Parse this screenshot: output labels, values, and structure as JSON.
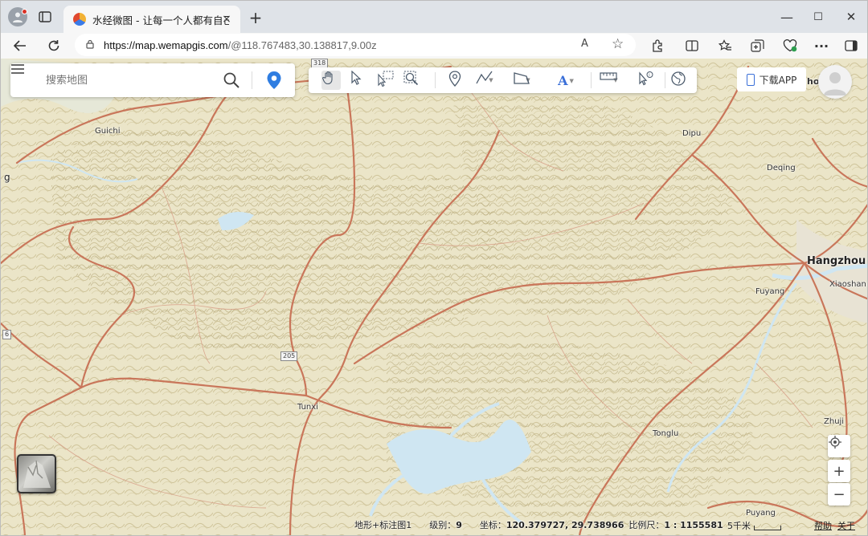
{
  "browser": {
    "tab_title": "水经微图 - 让每一个人都有自己的",
    "tab_close": "×",
    "new_tab": "+",
    "url_host": "https://map.wemapgis.com",
    "url_rest": "/@118.767483,30.138817,9.00z",
    "read_aloud": "A",
    "window_minimize": "—",
    "window_maximize": "☐",
    "window_close": "✕"
  },
  "search": {
    "placeholder": "搜索地图"
  },
  "toolbar": {
    "tools": [
      "pan-hand",
      "select-arrow",
      "box-select",
      "zoom-rect",
      "place-marker",
      "draw-line",
      "draw-polygon",
      "add-text",
      "measure",
      "identify",
      "globe"
    ]
  },
  "download_app_label": "下载APP",
  "places": {
    "guichi": "Guichi",
    "dipu": "Dipu",
    "deqing": "Deqing",
    "hangzhou": "Hangzhou",
    "xiaoshan": "Xiaoshan",
    "fuyang": "Fuyang",
    "tunxi": "Tunxi",
    "tonglu": "Tonglu",
    "zhuji": "Zhuji",
    "puyang": "Puyang",
    "left_edge": "g",
    "right_clip": "ho"
  },
  "shields": {
    "s205": "205",
    "s318": "318",
    "s6": "6"
  },
  "status": {
    "layer": "地形+标注图1",
    "zoom_label": "级别：",
    "zoom_value": "9",
    "coord_label": "坐标：",
    "coord_value": "120.379727, 29.738966",
    "scale_label": "比例尺：",
    "scale_value": "1 : 1155581",
    "scalebar_label": "5千米",
    "help": "帮助",
    "about": "关于"
  },
  "zoom": {
    "plus": "+",
    "minus": "−"
  },
  "colors": {
    "map_bg": "#ebe5c8",
    "road": "#c9765a",
    "water": "#cfe6f2",
    "accent": "#2f7de1"
  }
}
